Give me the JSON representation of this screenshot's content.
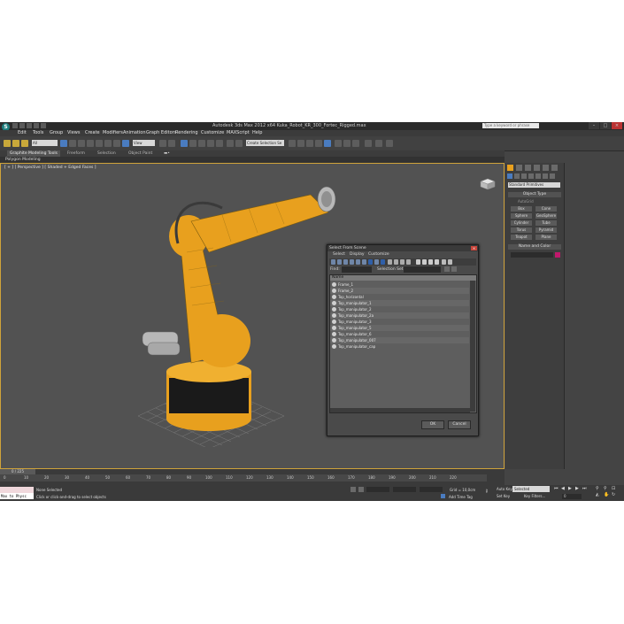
{
  "window": {
    "title": "Autodesk 3ds Max 2012 x64     Kuka_Robot_KR_300_Fortec_Rigged.max",
    "search_placeholder": "Type a keyword or phrase",
    "logo": "3ds-max-logo"
  },
  "menu": [
    "Edit",
    "Tools",
    "Group",
    "Views",
    "Create",
    "Modifiers",
    "Animation",
    "Graph Editors",
    "Rendering",
    "Customize",
    "MAXScript",
    "Help"
  ],
  "toolbar": {
    "selection_filter": "All",
    "reference_coord": "View",
    "named_selection": "Create Selection Se"
  },
  "ribbon": {
    "tabs": [
      "Graphite Modeling Tools",
      "Freeform",
      "Selection",
      "Object Paint"
    ],
    "subtitle": "Polygon Modeling"
  },
  "viewport": {
    "label": "[ + ] [ Perspective ] [ Shaded + Edged Faces ]"
  },
  "command_panel": {
    "category": "Standard Primitives",
    "rollout_object_type": "Object Type",
    "autogrid": "AutoGrid",
    "buttons": [
      "Box",
      "Cone",
      "Sphere",
      "GeoSphere",
      "Cylinder",
      "Tube",
      "Torus",
      "Pyramid",
      "Teapot",
      "Plane"
    ],
    "rollout_name_color": "Name and Color"
  },
  "timeline": {
    "slider": "0 / 225",
    "ticks": [
      "0",
      "10",
      "20",
      "30",
      "40",
      "50",
      "60",
      "70",
      "80",
      "90",
      "100",
      "110",
      "120",
      "130",
      "140",
      "150",
      "160",
      "170",
      "180",
      "190",
      "200",
      "210",
      "220"
    ]
  },
  "status": {
    "maxscript_text": "Max to Physc",
    "selection": "None Selected",
    "prompt": "Click or click-and-drag to select objects",
    "grid": "Grid = 10,0cm",
    "add_time_tag": "Add Time Tag",
    "auto_key": "Auto Key",
    "set_key": "Set Key",
    "key_mode": "Selected",
    "key_filters": "Key Filters...",
    "frame": "0"
  },
  "dialog": {
    "title": "Select From Scene",
    "menu": [
      "Select",
      "Display",
      "Customize"
    ],
    "find_label": "Find:",
    "selection_set": "Selection Set:",
    "column_header": "Name",
    "items": [
      "Frame_1",
      "Frame_2",
      "Top_horizontal",
      "Top_manipulator_1",
      "Top_manipulator_2",
      "Top_manipulator_2a",
      "Top_manipulator_3",
      "Top_manipulator_5",
      "Top_manipulator_6",
      "Top_manipulator_007",
      "Top_manipulator_cap"
    ],
    "ok": "OK",
    "cancel": "Cancel"
  },
  "colors": {
    "robot_orange": "#e8a01e",
    "viewport_bg": "#525252",
    "active_viewport_border": "#cfa33a"
  }
}
